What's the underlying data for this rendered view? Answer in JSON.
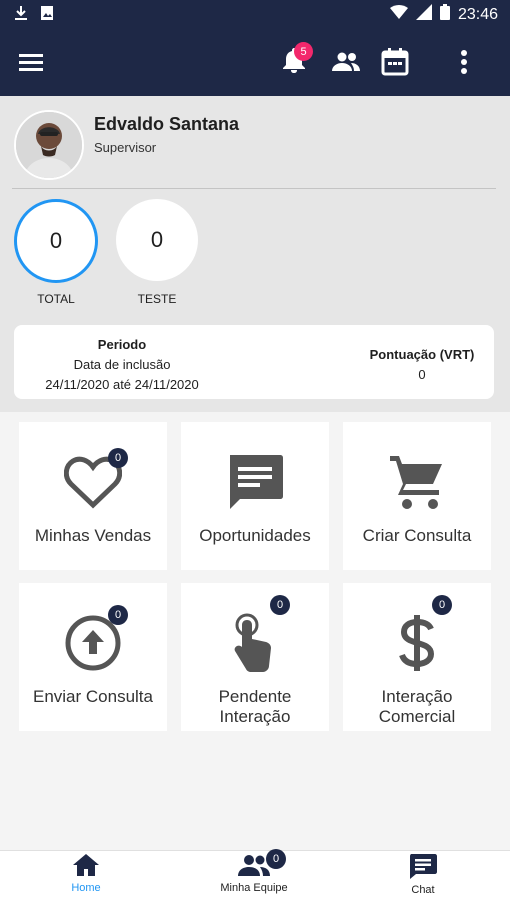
{
  "status_bar": {
    "time": "23:46"
  },
  "appbar": {
    "notification_count": "5"
  },
  "profile": {
    "name": "Edvaldo Santana",
    "role": "Supervisor"
  },
  "counters": [
    {
      "value": "0",
      "label": "TOTAL"
    },
    {
      "value": "0",
      "label": "TESTE"
    }
  ],
  "period_card": {
    "period_title": "Periodo",
    "period_subtitle": "Data de inclusão",
    "period_range": "24/11/2020 até 24/11/2020",
    "score_title": "Pontuação (VRT)",
    "score_value": "0"
  },
  "tiles": [
    {
      "label": "Minhas Vendas",
      "icon": "heart-icon",
      "count": "0"
    },
    {
      "label": "Oportunidades",
      "icon": "message-icon"
    },
    {
      "label": "Criar Consulta",
      "icon": "cart-icon"
    },
    {
      "label": "Enviar Consulta",
      "icon": "upload-icon",
      "count": "0"
    },
    {
      "label_line1": "Pendente",
      "label_line2": "Interação",
      "icon": "touch-icon",
      "count": "0"
    },
    {
      "label_line1": "Interação",
      "label_line2": "Comercial",
      "icon": "dollar-icon",
      "count": "0"
    }
  ],
  "bottom_nav": [
    {
      "label": "Home",
      "icon": "home-icon",
      "active": true
    },
    {
      "label": "Minha Equipe",
      "icon": "team-icon",
      "count": "0"
    },
    {
      "label": "Chat",
      "icon": "chat-icon"
    }
  ],
  "colors": {
    "primary": "#1e2846",
    "accent": "#2196f3",
    "badge": "#f3286c",
    "icon_gray": "#555555"
  }
}
